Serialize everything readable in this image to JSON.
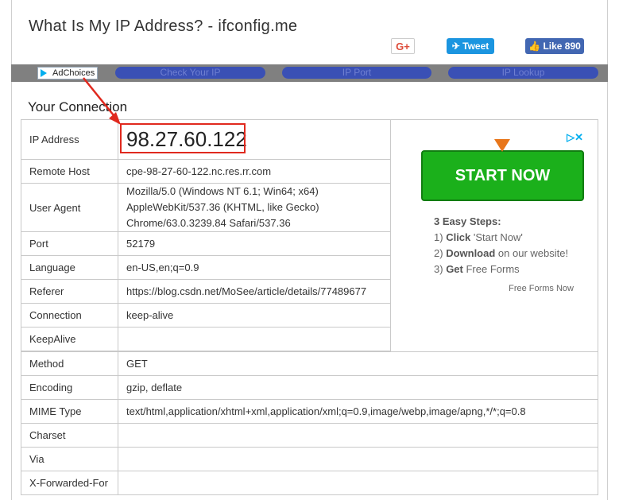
{
  "header": {
    "title": "What Is My IP Address? - ifconfig.me",
    "gplus_label": "G+",
    "tweet_label": "Tweet",
    "like_label": "Like 890"
  },
  "nav": {
    "adchoices_label": "AdChoices",
    "items": [
      "Check Your IP",
      "IP Port",
      "IP Lookup"
    ]
  },
  "section_title": "Your Connection",
  "rows": [
    {
      "label": "IP Address",
      "value": "98.27.60.122"
    },
    {
      "label": "Remote Host",
      "value": "cpe-98-27-60-122.nc.res.rr.com"
    },
    {
      "label": "User Agent",
      "value_lines": [
        "Mozilla/5.0 (Windows NT 6.1; Win64; x64)",
        "AppleWebKit/537.36 (KHTML, like Gecko)",
        "Chrome/63.0.3239.84 Safari/537.36"
      ]
    },
    {
      "label": "Port",
      "value": "52179"
    },
    {
      "label": "Language",
      "value": "en-US,en;q=0.9"
    },
    {
      "label": "Referer",
      "value": "https://blog.csdn.net/MoSee/article/details/77489677"
    },
    {
      "label": "Connection",
      "value": "keep-alive"
    },
    {
      "label": "KeepAlive",
      "value": ""
    },
    {
      "label": "Method",
      "value": "GET"
    },
    {
      "label": "Encoding",
      "value": "gzip, deflate"
    },
    {
      "label": "MIME Type",
      "value": "text/html,application/xhtml+xml,application/xml;q=0.9,image/webp,image/apng,*/*;q=0.8"
    },
    {
      "label": "Charset",
      "value": ""
    },
    {
      "label": "Via",
      "value": ""
    },
    {
      "label": "X-Forwarded-For",
      "value": ""
    }
  ],
  "ad": {
    "button_label": "START NOW",
    "steps_title": "3 Easy Steps:",
    "step1_num": "1)",
    "step1_bold": "Click",
    "step1_rest": " 'Start Now'",
    "step2_num": "2)",
    "step2_bold": "Download",
    "step2_rest": " on our website!",
    "step3_num": "3)",
    "step3_bold": "Get",
    "step3_rest": " Free Forms",
    "footer": "Free Forms Now",
    "close_icon": "▷✕"
  },
  "colors": {
    "highlight": "#e0291e",
    "nav_bar": "#808080",
    "nav_pill": "#3a50b5",
    "start_button": "#1bb01b"
  }
}
